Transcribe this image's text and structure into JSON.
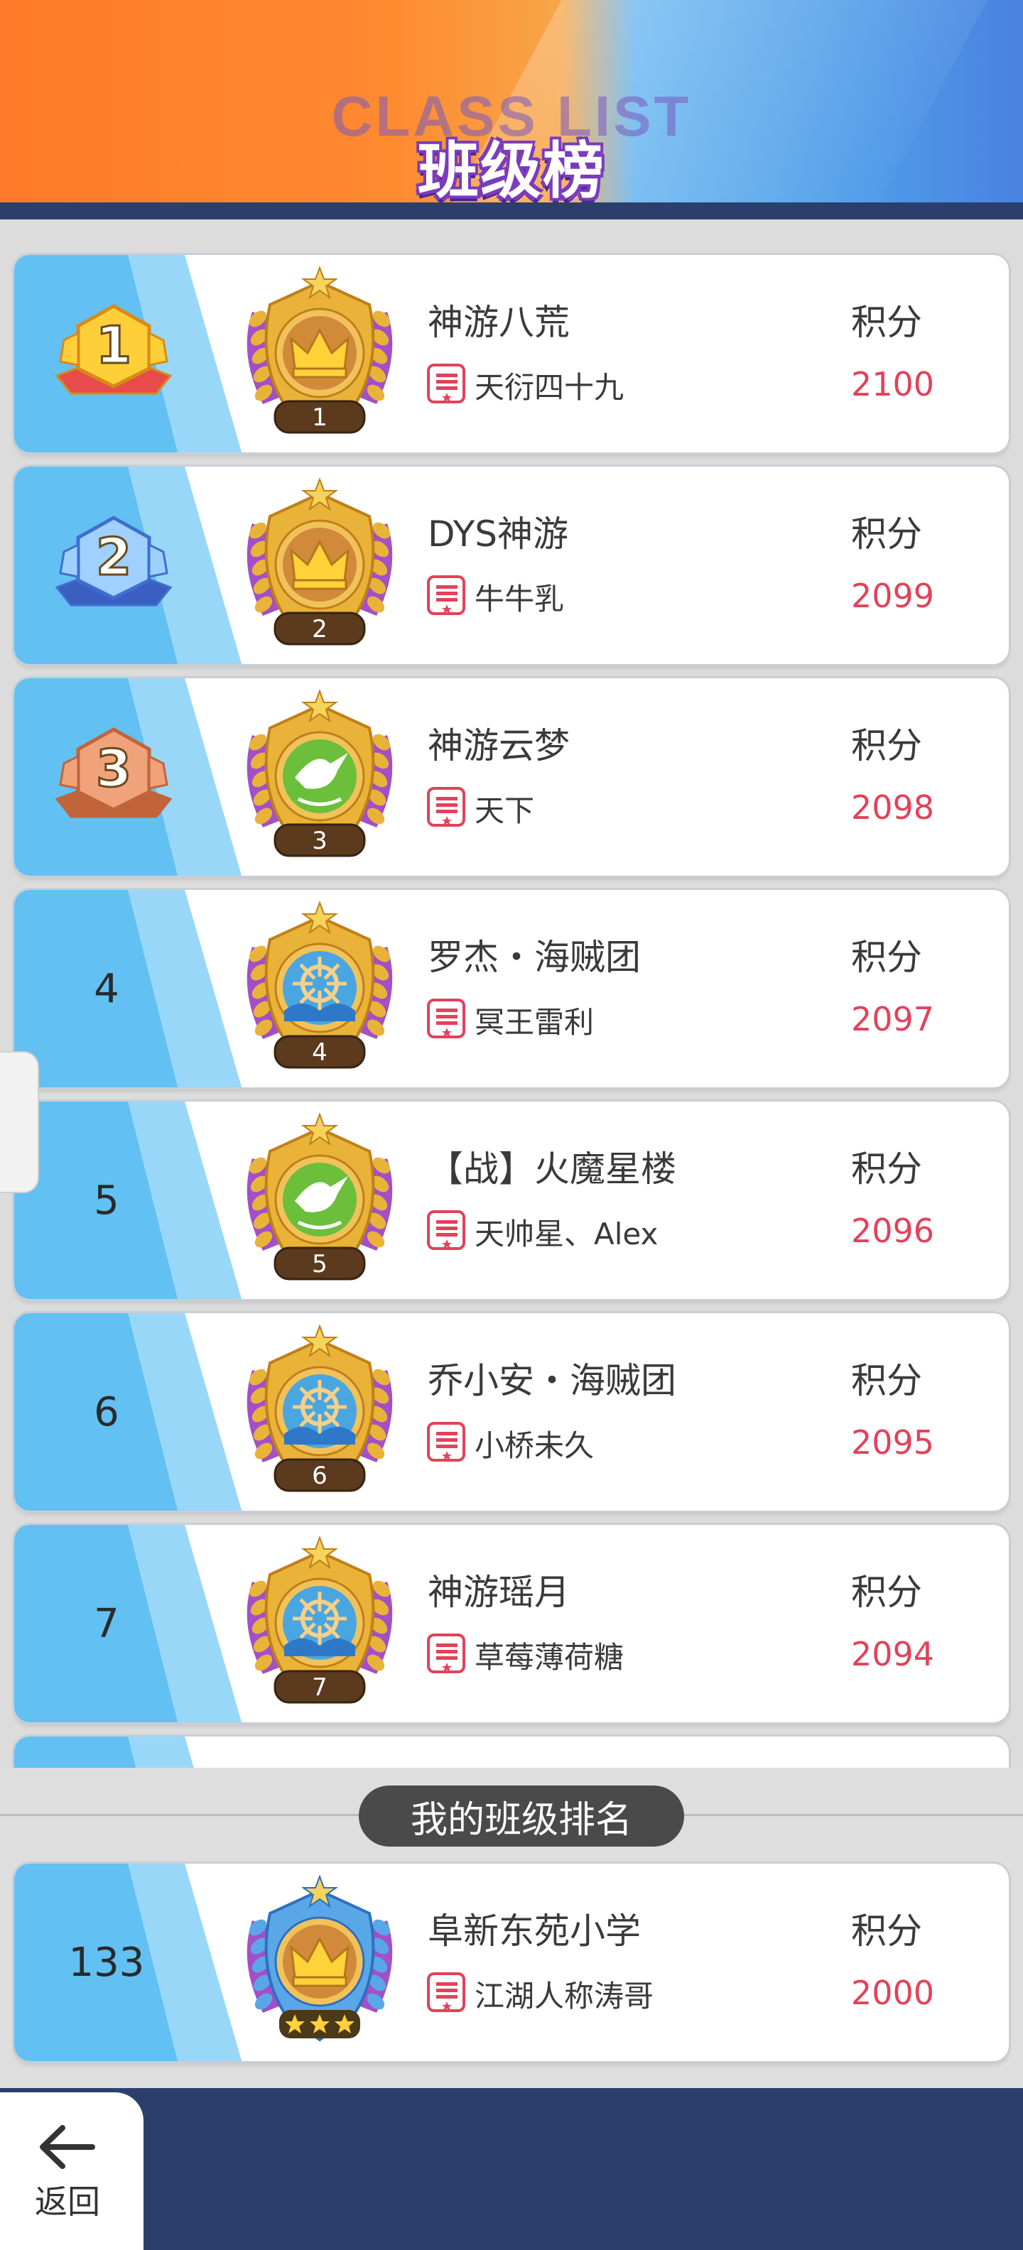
{
  "header": {
    "title_en": "CLASS LIST",
    "title_cn": "班级榜"
  },
  "list": {
    "score_label": "积分",
    "rows": [
      {
        "rank": "1",
        "team": "神游八荒",
        "leader": "天衍四十九",
        "score": "2100",
        "badge_emblem": "crown",
        "badge_number": "1",
        "rank_icon": "gold-trophy-icon"
      },
      {
        "rank": "2",
        "team": "DYS神游",
        "leader": "牛牛乳",
        "score": "2099",
        "badge_emblem": "crown",
        "badge_number": "2",
        "rank_icon": "silver-trophy-icon"
      },
      {
        "rank": "3",
        "team": "神游云梦",
        "leader": "天下",
        "score": "2098",
        "badge_emblem": "dove",
        "badge_number": "3",
        "rank_icon": "bronze-trophy-icon"
      },
      {
        "rank": "4",
        "team": "罗杰・海贼团",
        "leader": "冥王雷利",
        "score": "2097",
        "badge_emblem": "helm",
        "badge_number": "4",
        "rank_icon": ""
      },
      {
        "rank": "5",
        "team": "【战】火魔星楼",
        "leader": "天帅星、Alex",
        "score": "2096",
        "badge_emblem": "dove",
        "badge_number": "5",
        "rank_icon": ""
      },
      {
        "rank": "6",
        "team": "乔小安・海贼团",
        "leader": "小桥未久",
        "score": "2095",
        "badge_emblem": "helm",
        "badge_number": "6",
        "rank_icon": ""
      },
      {
        "rank": "7",
        "team": "神游瑶月",
        "leader": "草莓薄荷糖",
        "score": "2094",
        "badge_emblem": "helm",
        "badge_number": "7",
        "rank_icon": ""
      }
    ]
  },
  "my_rank": {
    "section_title": "我的班级排名",
    "rank": "133",
    "team": "阜新东苑小学",
    "leader": "江湖人称涛哥",
    "score_label": "积分",
    "score": "2000",
    "badge_emblem": "crown",
    "badge_stars": 3
  },
  "nav": {
    "back_label": "返回"
  },
  "colors": {
    "accent_red": "#e2425a",
    "rank_blue": "#62c0f2",
    "footer_navy": "#2b3f6c"
  }
}
